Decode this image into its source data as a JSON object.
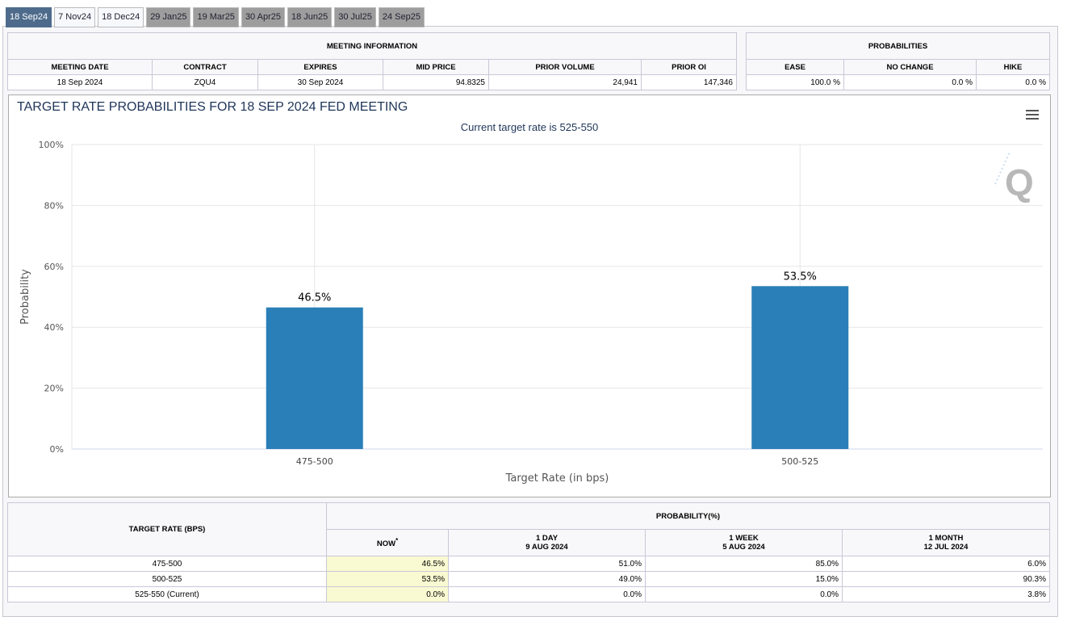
{
  "tabs": [
    "18 Sep24",
    "7 Nov24",
    "18 Dec24",
    "29 Jan25",
    "19 Mar25",
    "30 Apr25",
    "18 Jun25",
    "30 Jul25",
    "24 Sep25"
  ],
  "meeting": {
    "title": "MEETING INFORMATION",
    "headers": [
      "MEETING DATE",
      "CONTRACT",
      "EXPIRES",
      "MID PRICE",
      "PRIOR VOLUME",
      "PRIOR OI"
    ],
    "values": [
      "18 Sep 2024",
      "ZQU4",
      "30 Sep 2024",
      "94.8325",
      "24,941",
      "147,346"
    ]
  },
  "probabilities": {
    "title": "PROBABILITIES",
    "headers": [
      "EASE",
      "NO CHANGE",
      "HIKE"
    ],
    "values": [
      "100.0 %",
      "0.0 %",
      "0.0 %"
    ]
  },
  "chart_data": {
    "type": "bar",
    "title": "TARGET RATE PROBABILITIES FOR 18 SEP 2024 FED MEETING",
    "subtitle": "Current target rate is 525-550",
    "categories": [
      "475-500",
      "500-525"
    ],
    "values": [
      46.5,
      53.5
    ],
    "data_labels": [
      "46.5%",
      "53.5%"
    ],
    "xlabel": "Target Rate (in bps)",
    "ylabel": "Probability",
    "ylim": [
      0,
      100
    ],
    "yticks": [
      "0%",
      "20%",
      "40%",
      "60%",
      "80%",
      "100%"
    ],
    "color": "#2a7fb8"
  },
  "prob_table": {
    "rate_header": "TARGET RATE (BPS)",
    "group_header": "PROBABILITY(%)",
    "cols": [
      {
        "l1": "NOW",
        "sup": "*",
        "l2": ""
      },
      {
        "l1": "1 DAY",
        "l2": "9 AUG 2024"
      },
      {
        "l1": "1 WEEK",
        "l2": "5 AUG 2024"
      },
      {
        "l1": "1 MONTH",
        "l2": "12 JUL 2024"
      }
    ],
    "rows": [
      {
        "rate": "475-500",
        "v": [
          "46.5%",
          "51.0%",
          "85.0%",
          "6.0%"
        ]
      },
      {
        "rate": "500-525",
        "v": [
          "53.5%",
          "49.0%",
          "15.0%",
          "90.3%"
        ]
      },
      {
        "rate": "525-550 (Current)",
        "v": [
          "0.0%",
          "0.0%",
          "0.0%",
          "3.8%"
        ]
      }
    ]
  }
}
